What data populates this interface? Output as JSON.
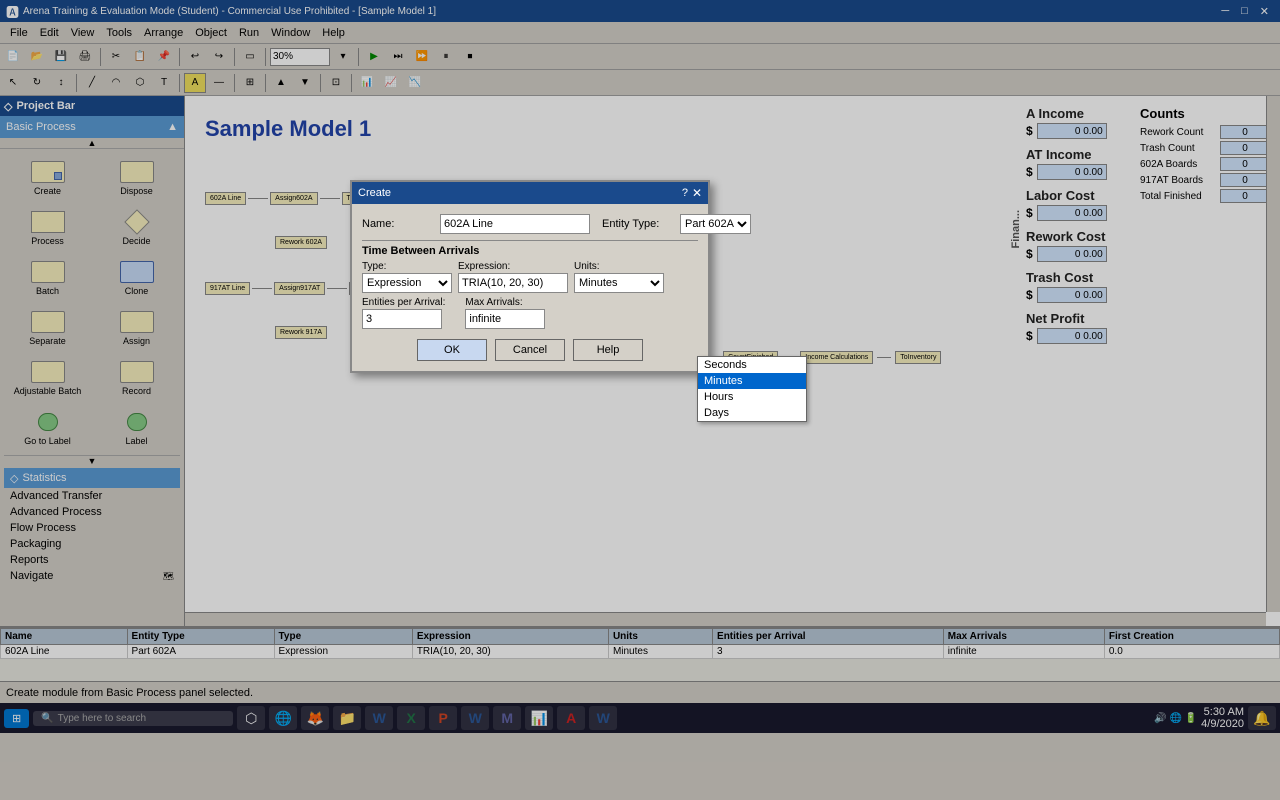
{
  "window": {
    "title": "Arena Training & Evaluation Mode (Student) - Commercial Use Prohibited - [Sample Model 1]",
    "icon": "🅰"
  },
  "menu": {
    "items": [
      "File",
      "Edit",
      "View",
      "Tools",
      "Arrange",
      "Object",
      "Run",
      "Window",
      "Help"
    ]
  },
  "toolbar1": {
    "zoom": "30%"
  },
  "project_bar": {
    "label": "Project Bar"
  },
  "panel": {
    "header": "Basic Process",
    "items": [
      {
        "id": "create",
        "label": "Create",
        "shape": "rect"
      },
      {
        "id": "dispose",
        "label": "Dispose",
        "shape": "rect"
      },
      {
        "id": "process",
        "label": "Process",
        "shape": "rect"
      },
      {
        "id": "decide",
        "label": "Decide",
        "shape": "diamond"
      },
      {
        "id": "batch",
        "label": "Batch",
        "shape": "rect"
      },
      {
        "id": "clone",
        "label": "Clone",
        "shape": "rect-blue"
      },
      {
        "id": "separate",
        "label": "Separate",
        "shape": "rect"
      },
      {
        "id": "assign",
        "label": "Assign",
        "shape": "rect"
      },
      {
        "id": "adj-batch",
        "label": "Adjustable Batch",
        "shape": "rect"
      },
      {
        "id": "record",
        "label": "Record",
        "shape": "rect"
      },
      {
        "id": "goto-label",
        "label": "Go to Label",
        "shape": "rect"
      },
      {
        "id": "label",
        "label": "Label",
        "shape": "rect"
      }
    ]
  },
  "panel_sections": [
    {
      "label": "Statistics",
      "expanded": false
    },
    {
      "label": "Advanced Transfer",
      "expanded": false
    },
    {
      "label": "Advanced Process",
      "expanded": false
    },
    {
      "label": "Flow Process",
      "expanded": false
    },
    {
      "label": "Packaging",
      "expanded": false
    },
    {
      "label": "Reports",
      "expanded": false
    },
    {
      "label": "Navigate",
      "expanded": false
    }
  ],
  "canvas": {
    "title": "Sample Model 1"
  },
  "dialog": {
    "title": "Create",
    "help_btn": "?",
    "close_btn": "✕",
    "name_label": "Name:",
    "name_value": "602A Line",
    "entity_type_label": "Entity Type:",
    "entity_type_value": "Part 602A",
    "section_tba": "Time Between Arrivals",
    "type_label": "Type:",
    "type_value": "Expression",
    "expression_label": "Expression:",
    "expression_value": "TRIA(10, 20, 30)",
    "units_label": "Units:",
    "units_value": "Minutes",
    "epa_label": "Entities per Arrival:",
    "epa_value": "3",
    "max_label": "Max Arrivals:",
    "max_value": "infinite",
    "btn_ok": "OK",
    "btn_cancel": "Cancel",
    "btn_help": "Help"
  },
  "dropdown": {
    "items": [
      "Seconds",
      "Minutes",
      "Hours",
      "Days"
    ],
    "selected": "Minutes"
  },
  "right_panel": {
    "income_section": {
      "title": "A Income",
      "dollar": "$",
      "value": "0  0.00"
    },
    "at_income": {
      "title": "AT Income",
      "dollar": "$",
      "value": "0  0.00"
    },
    "labor_cost": {
      "title": "Labor Cost",
      "dollar": "$",
      "value": "0  0.00"
    },
    "rework_cost": {
      "title": "Rework Cost",
      "dollar": "$",
      "value": "0  0.00"
    },
    "trash_cost": {
      "title": "Trash Cost",
      "dollar": "$",
      "value": "0  0.00"
    },
    "net_profit": {
      "title": "Net Profit",
      "dollar": "$",
      "value": "0  0.00"
    },
    "finan_label": "Finan...",
    "counts": {
      "title": "Counts",
      "rows": [
        {
          "label": "Rework Count",
          "value": "0"
        },
        {
          "label": "Trash Count",
          "value": "0"
        },
        {
          "label": "602A Boards",
          "value": "0"
        },
        {
          "label": "917AT Boards",
          "value": "0"
        },
        {
          "label": "Total Finished",
          "value": "0"
        }
      ]
    }
  },
  "bottom_table": {
    "headers": [
      "Name",
      "Entity Type",
      "Type",
      "Expression",
      "Units",
      "Entities per Arrival",
      "Max Arrivals",
      "First Creation"
    ],
    "rows": [
      [
        "602A Line",
        "Part 602A",
        "Expression",
        "TRIA(10, 20, 30)",
        "Minutes",
        "3",
        "infinite",
        "0.0"
      ]
    ]
  },
  "status_bar": {
    "text": "Create module from Basic Process panel selected."
  },
  "taskbar": {
    "start": "⊞",
    "search_placeholder": "Type here to search",
    "clock": "5:30 AM",
    "date": "4/9/2020",
    "apps": [
      "🔍",
      "⬡",
      "🦊",
      "📁",
      "W",
      "X",
      "P",
      "W",
      "M",
      "📊",
      "A",
      "W"
    ]
  }
}
